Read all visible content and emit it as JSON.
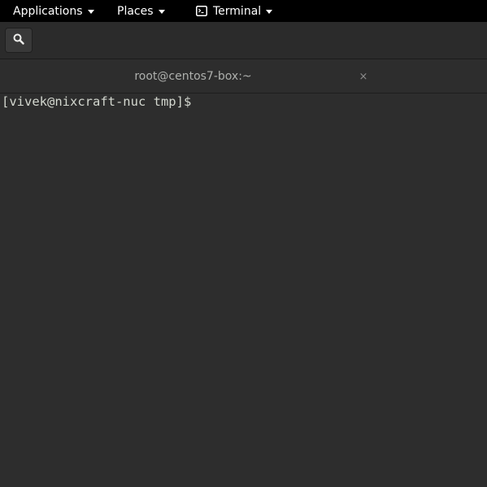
{
  "topbar": {
    "applications_label": "Applications",
    "places_label": "Places",
    "terminal_label": "Terminal"
  },
  "headerbar": {
    "search_icon": "search-icon"
  },
  "tab": {
    "title": "root@centos7-box:~",
    "close_glyph": "×"
  },
  "terminal": {
    "prompt": "[vivek@nixcraft-nuc tmp]$ "
  },
  "colors": {
    "topbar_bg": "#000000",
    "window_bg": "#2d2d2d",
    "terminal_fg": "#d3d7cf",
    "tab_title_fg": "#aeb0ad"
  }
}
